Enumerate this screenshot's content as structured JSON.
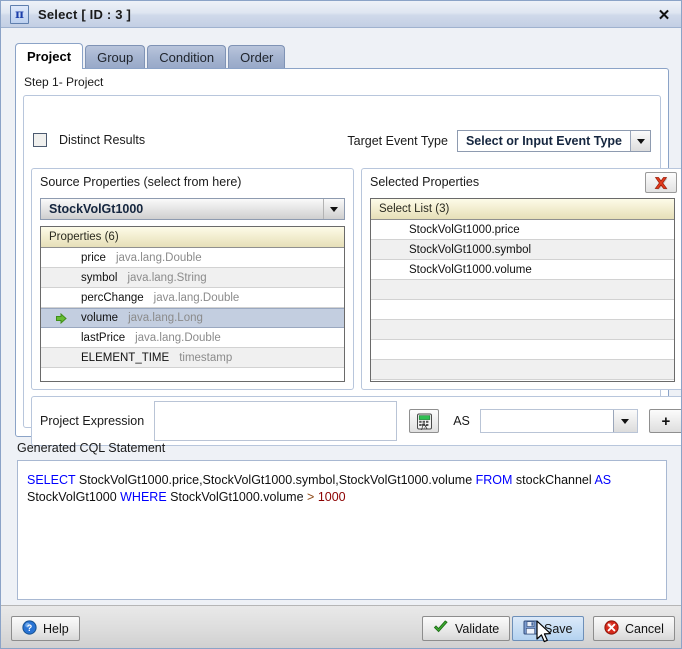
{
  "window": {
    "title": "Select [ ID : 3 ]",
    "icon": "pi-icon",
    "icon_glyph": "π",
    "close_label": "✕"
  },
  "tabs": [
    {
      "label": "Project",
      "active": true
    },
    {
      "label": "Group",
      "active": false
    },
    {
      "label": "Condition",
      "active": false
    },
    {
      "label": "Order",
      "active": false
    }
  ],
  "step": {
    "label": "Step 1- Project"
  },
  "distinct": {
    "label": "Distinct Results",
    "checked": false
  },
  "target_event_type": {
    "label": "Target Event Type",
    "value": "Select or Input Event Type"
  },
  "source": {
    "title": "Source Properties (select from here)",
    "stream_value": "StockVolGt1000",
    "list_header": "Properties (6)",
    "rows": [
      {
        "name": "price",
        "type": "java.lang.Double",
        "selected": false
      },
      {
        "name": "symbol",
        "type": "java.lang.String",
        "selected": false
      },
      {
        "name": "percChange",
        "type": "java.lang.Double",
        "selected": false
      },
      {
        "name": "volume",
        "type": "java.lang.Long",
        "selected": true
      },
      {
        "name": "lastPrice",
        "type": "java.lang.Double",
        "selected": false
      },
      {
        "name": "ELEMENT_TIME",
        "type": "timestamp",
        "selected": false
      }
    ]
  },
  "selected": {
    "title": "Selected Properties",
    "delete_icon": "red-x-icon",
    "list_header": "Select List (3)",
    "rows": [
      "StockVolGt1000.price",
      "StockVolGt1000.symbol",
      "StockVolGt1000.volume"
    ],
    "empty_rows": 6
  },
  "expression": {
    "label": "Project Expression",
    "value": "",
    "builder_icon": "function-calculator-icon",
    "as_label": "AS",
    "as_value": "",
    "add_label": "+"
  },
  "cql": {
    "label": "Generated CQL Statement",
    "tokens": [
      {
        "t": "SELECT",
        "c": "kw"
      },
      {
        "t": " StockVolGt1000.price,StockVolGt1000.symbol,StockVolGt1000.volume ",
        "c": ""
      },
      {
        "t": "FROM",
        "c": "kw"
      },
      {
        "t": " stockChannel ",
        "c": ""
      },
      {
        "t": "AS",
        "c": "kw"
      },
      {
        "t": " StockVolGt1000 ",
        "c": ""
      },
      {
        "t": "WHERE",
        "c": "kw"
      },
      {
        "t": " StockVolGt1000.volume ",
        "c": ""
      },
      {
        "t": ">",
        "c": "op"
      },
      {
        "t": " ",
        "c": ""
      },
      {
        "t": "1000",
        "c": "num"
      }
    ],
    "plain": "SELECT StockVolGt1000.price,StockVolGt1000.symbol,StockVolGt1000.volume FROM stockChannel AS StockVolGt1000 WHERE StockVolGt1000.volume > 1000"
  },
  "footer": {
    "help": "Help",
    "validate": "Validate",
    "save": "Save",
    "cancel": "Cancel"
  },
  "colors": {
    "keyword": "#0000ff",
    "number": "#8b0000",
    "operator": "#8b4513",
    "accent": "#1d3faa",
    "selection": "#c3cee0"
  }
}
